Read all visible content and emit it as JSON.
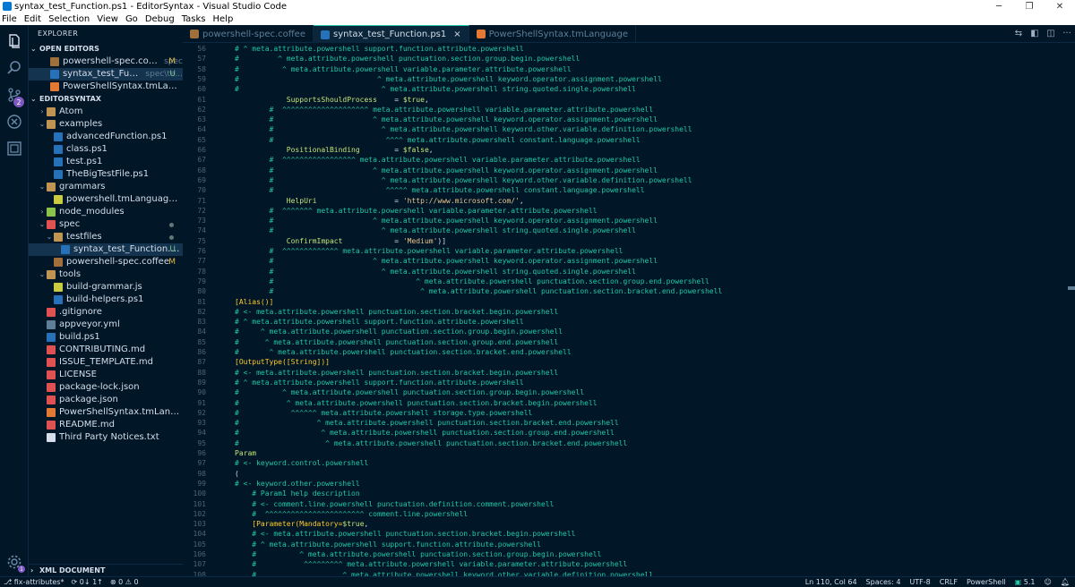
{
  "window": {
    "title": "syntax_test_Function.ps1 - EditorSyntax - Visual Studio Code"
  },
  "menu": [
    "File",
    "Edit",
    "Selection",
    "View",
    "Go",
    "Debug",
    "Tasks",
    "Help"
  ],
  "activity": {
    "scm_badge": "2"
  },
  "sidebar": {
    "title": "EXPLORER",
    "open_editors_label": "OPEN EDITORS",
    "open_editors": [
      {
        "name": "powershell-spec.coffee",
        "sub": "spec",
        "status": "M",
        "icon_color": "#a0703c"
      },
      {
        "name": "syntax_test_Function.ps1",
        "sub": "spec\\te...",
        "status": "U",
        "icon_color": "#2671b8"
      },
      {
        "name": "PowerShellSyntax.tmLanguage",
        "sub": "",
        "status": "",
        "icon_color": "#e37933"
      }
    ],
    "project_label": "EDITORSYNTAX",
    "tree": [
      {
        "name": "Atom",
        "depth": 0,
        "arrow": "›",
        "icon_color": "#c09553",
        "status": ""
      },
      {
        "name": "examples",
        "depth": 0,
        "arrow": "⌄",
        "icon_color": "#c09553",
        "status": ""
      },
      {
        "name": "advancedFunction.ps1",
        "depth": 1,
        "arrow": "",
        "icon_color": "#2671b8",
        "status": ""
      },
      {
        "name": "class.ps1",
        "depth": 1,
        "arrow": "",
        "icon_color": "#2671b8",
        "status": ""
      },
      {
        "name": "test.ps1",
        "depth": 1,
        "arrow": "",
        "icon_color": "#2671b8",
        "status": ""
      },
      {
        "name": "TheBigTestFile.ps1",
        "depth": 1,
        "arrow": "",
        "icon_color": "#2671b8",
        "status": ""
      },
      {
        "name": "grammars",
        "depth": 0,
        "arrow": "⌄",
        "icon_color": "#c09553",
        "status": ""
      },
      {
        "name": "powershell.tmLanguage.json",
        "depth": 1,
        "arrow": "",
        "icon_color": "#cbcb41",
        "status": ""
      },
      {
        "name": "node_modules",
        "depth": 0,
        "arrow": "›",
        "icon_color": "#8bc34a",
        "status": ""
      },
      {
        "name": "spec",
        "depth": 0,
        "arrow": "⌄",
        "icon_color": "#e05252",
        "status": "dot"
      },
      {
        "name": "testfiles",
        "depth": 1,
        "arrow": "⌄",
        "icon_color": "#c09553",
        "status": "dot"
      },
      {
        "name": "syntax_test_Function.ps1",
        "depth": 2,
        "arrow": "",
        "icon_color": "#2671b8",
        "status": "U",
        "selected": true
      },
      {
        "name": "powershell-spec.coffee",
        "depth": 1,
        "arrow": "",
        "icon_color": "#a0703c",
        "status": "M"
      },
      {
        "name": "tools",
        "depth": 0,
        "arrow": "⌄",
        "icon_color": "#c09553",
        "status": ""
      },
      {
        "name": "build-grammar.js",
        "depth": 1,
        "arrow": "",
        "icon_color": "#cbcb41",
        "status": ""
      },
      {
        "name": "build-helpers.ps1",
        "depth": 1,
        "arrow": "",
        "icon_color": "#2671b8",
        "status": ""
      },
      {
        "name": ".gitignore",
        "depth": 0,
        "arrow": "",
        "icon_color": "#e05252",
        "status": ""
      },
      {
        "name": "appveyor.yml",
        "depth": 0,
        "arrow": "",
        "icon_color": "#5f7e97",
        "status": ""
      },
      {
        "name": "build.ps1",
        "depth": 0,
        "arrow": "",
        "icon_color": "#2671b8",
        "status": ""
      },
      {
        "name": "CONTRIBUTING.md",
        "depth": 0,
        "arrow": "",
        "icon_color": "#e05252",
        "status": ""
      },
      {
        "name": "ISSUE_TEMPLATE.md",
        "depth": 0,
        "arrow": "",
        "icon_color": "#e05252",
        "status": ""
      },
      {
        "name": "LICENSE",
        "depth": 0,
        "arrow": "",
        "icon_color": "#e05252",
        "status": ""
      },
      {
        "name": "package-lock.json",
        "depth": 0,
        "arrow": "",
        "icon_color": "#e05252",
        "status": ""
      },
      {
        "name": "package.json",
        "depth": 0,
        "arrow": "",
        "icon_color": "#e05252",
        "status": ""
      },
      {
        "name": "PowerShellSyntax.tmLanguage",
        "depth": 0,
        "arrow": "",
        "icon_color": "#e37933",
        "status": ""
      },
      {
        "name": "README.md",
        "depth": 0,
        "arrow": "",
        "icon_color": "#e05252",
        "status": ""
      },
      {
        "name": "Third Party Notices.txt",
        "depth": 0,
        "arrow": "",
        "icon_color": "#d6deeb",
        "status": ""
      }
    ],
    "xml_label": "XML DOCUMENT"
  },
  "tabs": [
    {
      "name": "powershell-spec.coffee",
      "active": false,
      "icon_color": "#a0703c"
    },
    {
      "name": "syntax_test_Function.ps1",
      "active": true,
      "icon_color": "#2671b8"
    },
    {
      "name": "PowerShellSyntax.tmLanguage",
      "active": false,
      "icon_color": "#e37933"
    }
  ],
  "editor": {
    "lines": [
      {
        "n": "56",
        "parts": [
          [
            "c-cmt",
            "# ^ meta.attribute.powershell support.function.attribute.powershell"
          ]
        ]
      },
      {
        "n": "57",
        "parts": [
          [
            "c-cmt",
            "#         ^ meta.attribute.powershell punctuation.section.group.begin.powershell"
          ]
        ]
      },
      {
        "n": "58",
        "parts": [
          [
            "c-cmt",
            "#          ^ meta.attribute.powershell variable.parameter.attribute.powershell"
          ]
        ]
      },
      {
        "n": "59",
        "parts": [
          [
            "c-cmt",
            "#                                ^ meta.attribute.powershell keyword.operator.assignment.powershell"
          ]
        ]
      },
      {
        "n": "60",
        "parts": [
          [
            "c-cmt",
            "#                                 ^ meta.attribute.powershell string.quoted.single.powershell"
          ]
        ]
      },
      {
        "n": "61",
        "parts": [
          [
            "c-plain",
            "            "
          ],
          [
            "c-key",
            "SupportsShouldProcess"
          ],
          [
            "c-plain",
            "    = "
          ],
          [
            "c-var",
            "$true"
          ],
          [
            "c-plain",
            ","
          ]
        ]
      },
      {
        "n": "62",
        "parts": [
          [
            "c-cmt",
            "        #  ^^^^^^^^^^^^^^^^^^^^ meta.attribute.powershell variable.parameter.attribute.powershell"
          ]
        ]
      },
      {
        "n": "63",
        "parts": [
          [
            "c-cmt",
            "        #                       ^ meta.attribute.powershell keyword.operator.assignment.powershell"
          ]
        ]
      },
      {
        "n": "64",
        "parts": [
          [
            "c-cmt",
            "        #                         ^ meta.attribute.powershell keyword.other.variable.definition.powershell"
          ]
        ]
      },
      {
        "n": "65",
        "parts": [
          [
            "c-cmt",
            "        #                          ^^^^ meta.attribute.powershell constant.language.powershell"
          ]
        ]
      },
      {
        "n": "66",
        "parts": [
          [
            "c-plain",
            "            "
          ],
          [
            "c-key",
            "PositionalBinding"
          ],
          [
            "c-plain",
            "        = "
          ],
          [
            "c-var",
            "$false"
          ],
          [
            "c-plain",
            ","
          ]
        ]
      },
      {
        "n": "67",
        "parts": [
          [
            "c-cmt",
            "        #  ^^^^^^^^^^^^^^^^^ meta.attribute.powershell variable.parameter.attribute.powershell"
          ]
        ]
      },
      {
        "n": "68",
        "parts": [
          [
            "c-cmt",
            "        #                       ^ meta.attribute.powershell keyword.operator.assignment.powershell"
          ]
        ]
      },
      {
        "n": "69",
        "parts": [
          [
            "c-cmt",
            "        #                         ^ meta.attribute.powershell keyword.other.variable.definition.powershell"
          ]
        ]
      },
      {
        "n": "70",
        "parts": [
          [
            "c-cmt",
            "        #                          ^^^^^ meta.attribute.powershell constant.language.powershell"
          ]
        ]
      },
      {
        "n": "71",
        "parts": [
          [
            "c-plain",
            "            "
          ],
          [
            "c-key",
            "HelpUri"
          ],
          [
            "c-plain",
            "                  = "
          ],
          [
            "c-str",
            "'http://www.microsoft.com/'"
          ],
          [
            "c-plain",
            ","
          ]
        ]
      },
      {
        "n": "72",
        "parts": [
          [
            "c-cmt",
            "        #  ^^^^^^^ meta.attribute.powershell variable.parameter.attribute.powershell"
          ]
        ]
      },
      {
        "n": "73",
        "parts": [
          [
            "c-cmt",
            "        #                       ^ meta.attribute.powershell keyword.operator.assignment.powershell"
          ]
        ]
      },
      {
        "n": "74",
        "parts": [
          [
            "c-cmt",
            "        #                         ^ meta.attribute.powershell string.quoted.single.powershell"
          ]
        ]
      },
      {
        "n": "75",
        "parts": [
          [
            "c-plain",
            "            "
          ],
          [
            "c-key",
            "ConfirmImpact"
          ],
          [
            "c-plain",
            "            = "
          ],
          [
            "c-str",
            "'Medium'"
          ],
          [
            "c-plain",
            ")]"
          ]
        ]
      },
      {
        "n": "76",
        "parts": [
          [
            "c-cmt",
            "        #  ^^^^^^^^^^^^^ meta.attribute.powershell variable.parameter.attribute.powershell"
          ]
        ]
      },
      {
        "n": "77",
        "parts": [
          [
            "c-cmt",
            "        #                       ^ meta.attribute.powershell keyword.operator.assignment.powershell"
          ]
        ]
      },
      {
        "n": "78",
        "parts": [
          [
            "c-cmt",
            "        #                         ^ meta.attribute.powershell string.quoted.single.powershell"
          ]
        ]
      },
      {
        "n": "79",
        "parts": [
          [
            "c-cmt",
            "        #                                 ^ meta.attribute.powershell punctuation.section.group.end.powershell"
          ]
        ]
      },
      {
        "n": "80",
        "parts": [
          [
            "c-cmt",
            "        #                                  ^ meta.attribute.powershell punctuation.section.bracket.end.powershell"
          ]
        ]
      },
      {
        "n": "81",
        "parts": [
          [
            "c-brk",
            "[Alias()]"
          ]
        ]
      },
      {
        "n": "82",
        "parts": [
          [
            "c-cmt",
            "# <- meta.attribute.powershell punctuation.section.bracket.begin.powershell"
          ]
        ]
      },
      {
        "n": "83",
        "parts": [
          [
            "c-cmt",
            "# ^ meta.attribute.powershell support.function.attribute.powershell"
          ]
        ]
      },
      {
        "n": "84",
        "parts": [
          [
            "c-cmt",
            "#     ^ meta.attribute.powershell punctuation.section.group.begin.powershell"
          ]
        ]
      },
      {
        "n": "85",
        "parts": [
          [
            "c-cmt",
            "#      ^ meta.attribute.powershell punctuation.section.group.end.powershell"
          ]
        ]
      },
      {
        "n": "86",
        "parts": [
          [
            "c-cmt",
            "#       ^ meta.attribute.powershell punctuation.section.bracket.end.powershell"
          ]
        ]
      },
      {
        "n": "87",
        "parts": [
          [
            "c-brk",
            "[OutputType([String])]"
          ]
        ]
      },
      {
        "n": "88",
        "parts": [
          [
            "c-cmt",
            "# <- meta.attribute.powershell punctuation.section.bracket.begin.powershell"
          ]
        ]
      },
      {
        "n": "89",
        "parts": [
          [
            "c-cmt",
            "# ^ meta.attribute.powershell support.function.attribute.powershell"
          ]
        ]
      },
      {
        "n": "90",
        "parts": [
          [
            "c-cmt",
            "#          ^ meta.attribute.powershell punctuation.section.group.begin.powershell"
          ]
        ]
      },
      {
        "n": "91",
        "parts": [
          [
            "c-cmt",
            "#           ^ meta.attribute.powershell punctuation.section.bracket.begin.powershell"
          ]
        ]
      },
      {
        "n": "92",
        "parts": [
          [
            "c-cmt",
            "#            ^^^^^^ meta.attribute.powershell storage.type.powershell"
          ]
        ]
      },
      {
        "n": "93",
        "parts": [
          [
            "c-cmt",
            "#                  ^ meta.attribute.powershell punctuation.section.bracket.end.powershell"
          ]
        ]
      },
      {
        "n": "94",
        "parts": [
          [
            "c-cmt",
            "#                   ^ meta.attribute.powershell punctuation.section.group.end.powershell"
          ]
        ]
      },
      {
        "n": "95",
        "parts": [
          [
            "c-cmt",
            "#                    ^ meta.attribute.powershell punctuation.section.bracket.end.powershell"
          ]
        ]
      },
      {
        "n": "96",
        "parts": [
          [
            "c-key",
            "Param"
          ]
        ]
      },
      {
        "n": "97",
        "parts": [
          [
            "c-cmt",
            "# <- keyword.control.powershell"
          ]
        ]
      },
      {
        "n": "98",
        "parts": [
          [
            "c-plain",
            "("
          ]
        ]
      },
      {
        "n": "99",
        "parts": [
          [
            "c-cmt",
            "# <- keyword.other.powershell"
          ]
        ]
      },
      {
        "n": "100",
        "parts": [
          [
            "c-cmt",
            "    # Param1 help description"
          ]
        ]
      },
      {
        "n": "101",
        "parts": [
          [
            "c-cmt",
            "    # <- comment.line.powershell punctuation.definition.comment.powershell"
          ]
        ]
      },
      {
        "n": "102",
        "parts": [
          [
            "c-cmt",
            "    #  ^^^^^^^^^^^^^^^^^^^^^^^ comment.line.powershell"
          ]
        ]
      },
      {
        "n": "103",
        "parts": [
          [
            "c-brk",
            "    [Parameter(Mandatory="
          ],
          [
            "c-var",
            "$true"
          ],
          [
            "c-plain",
            ","
          ]
        ]
      },
      {
        "n": "104",
        "parts": [
          [
            "c-cmt",
            "    # <- meta.attribute.powershell punctuation.section.bracket.begin.powershell"
          ]
        ]
      },
      {
        "n": "105",
        "parts": [
          [
            "c-cmt",
            "    # ^ meta.attribute.powershell support.function.attribute.powershell"
          ]
        ]
      },
      {
        "n": "106",
        "parts": [
          [
            "c-cmt",
            "    #          ^ meta.attribute.powershell punctuation.section.group.begin.powershell"
          ]
        ]
      },
      {
        "n": "107",
        "parts": [
          [
            "c-cmt",
            "    #           ^^^^^^^^^ meta.attribute.powershell variable.parameter.attribute.powershell"
          ]
        ]
      },
      {
        "n": "108",
        "parts": [
          [
            "c-cmt",
            "    #                    ^ meta.attribute.powershell keyword.other.variable.definition.powershell"
          ]
        ]
      }
    ]
  },
  "statusbar": {
    "branch": "fix-attributes*",
    "sync": "0↓ 1↑",
    "problems": "⊗ 0 ⚠ 0",
    "position": "Ln 110, Col 64",
    "spaces": "Spaces: 4",
    "encoding": "UTF-8",
    "eol": "CRLF",
    "language": "PowerShell",
    "version": "5.1"
  }
}
